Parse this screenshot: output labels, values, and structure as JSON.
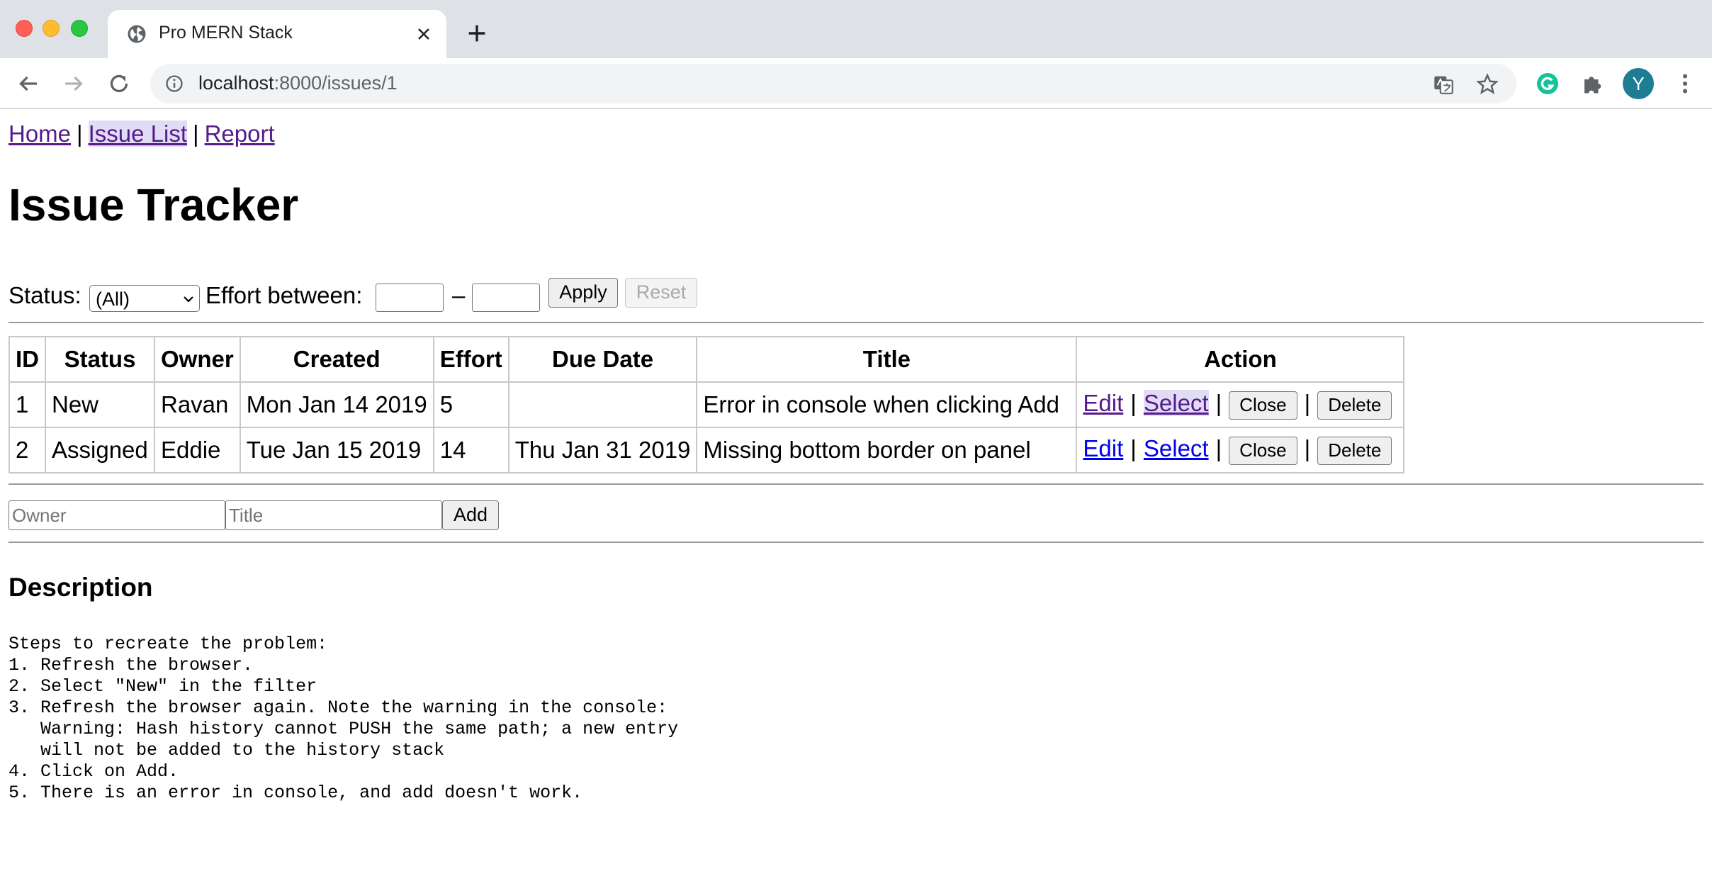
{
  "browser": {
    "tab_title": "Pro MERN Stack",
    "url_host": "localhost",
    "url_path": ":8000/issues/1",
    "avatar_letter": "Y"
  },
  "nav": {
    "home": "Home",
    "issue_list": "Issue List",
    "report": "Report",
    "separator": "|"
  },
  "page_title": "Issue Tracker",
  "filter": {
    "status_label": "Status:",
    "status_value": "(All)",
    "effort_label": "Effort between:",
    "dash": "–",
    "apply_label": "Apply",
    "reset_label": "Reset"
  },
  "table": {
    "headers": [
      "ID",
      "Status",
      "Owner",
      "Created",
      "Effort",
      "Due Date",
      "Title",
      "Action"
    ],
    "rows": [
      {
        "id": "1",
        "status": "New",
        "owner": "Ravan",
        "created": "Mon Jan 14 2019",
        "effort": "5",
        "due": "",
        "title": "Error in console when clicking Add"
      },
      {
        "id": "2",
        "status": "Assigned",
        "owner": "Eddie",
        "created": "Tue Jan 15 2019",
        "effort": "14",
        "due": "Thu Jan 31 2019",
        "title": "Missing bottom border on panel"
      }
    ],
    "actions": {
      "edit": "Edit",
      "select": "Select",
      "close": "Close",
      "delete": "Delete",
      "separator": "|"
    }
  },
  "add_form": {
    "owner_placeholder": "Owner",
    "title_placeholder": "Title",
    "add_label": "Add"
  },
  "description": {
    "heading": "Description",
    "text": "Steps to recreate the problem:\n1. Refresh the browser.\n2. Select \"New\" in the filter\n3. Refresh the browser again. Note the warning in the console:\n   Warning: Hash history cannot PUSH the same path; a new entry\n   will not be added to the history stack\n4. Click on Add.\n5. There is an error in console, and add doesn't work."
  }
}
